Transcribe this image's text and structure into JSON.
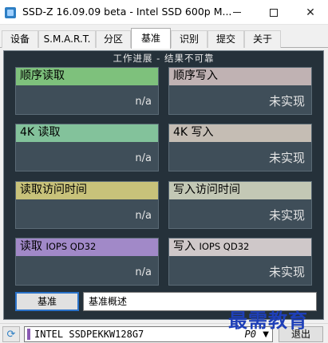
{
  "window": {
    "title": "SSD-Z 16.09.09 beta - Intel SSD 600p M..."
  },
  "tabs": [
    {
      "label": "设备"
    },
    {
      "label": "S.M.A.R.T."
    },
    {
      "label": "分区"
    },
    {
      "label": "基准"
    },
    {
      "label": "识别"
    },
    {
      "label": "提交"
    },
    {
      "label": "关于"
    }
  ],
  "active_tab": "基准",
  "benchmark": {
    "caption": "工作进展 - 结果不可靠",
    "cards": [
      {
        "label": "顺序读取",
        "value": "n/a"
      },
      {
        "label": "顺序写入",
        "value": "未实现"
      },
      {
        "label": "4K 读取",
        "value": "n/a"
      },
      {
        "label": "4K 写入",
        "value": "未实现"
      },
      {
        "label": "读取访问时间",
        "value": "n/a"
      },
      {
        "label": "写入访问时间",
        "value": "未实现"
      },
      {
        "label_main": "读取",
        "label_sub": "IOPS QD32",
        "value": "n/a"
      },
      {
        "label_main": "写入",
        "label_sub": "IOPS QD32",
        "value": "未实现"
      }
    ],
    "run_button": "基准",
    "description_select": "基准概述"
  },
  "status_bar": {
    "drive_name": "INTEL SSDPEKKW128G7",
    "drive_port": "P0"
  },
  "exit_button": "退出",
  "watermark": "最需教育",
  "colors": {
    "panel_bg": "#25313a",
    "seq_read": "#7ec17c",
    "seq_write": "#c0b2b3",
    "k4_read": "#83c29b",
    "k4_write": "#c5bdb4",
    "access_read": "#c8c27a",
    "access_write": "#c3c8b5",
    "iops_read": "#a189c8",
    "iops_write": "#cfc8c9",
    "watermark": "#1e3fb8"
  }
}
